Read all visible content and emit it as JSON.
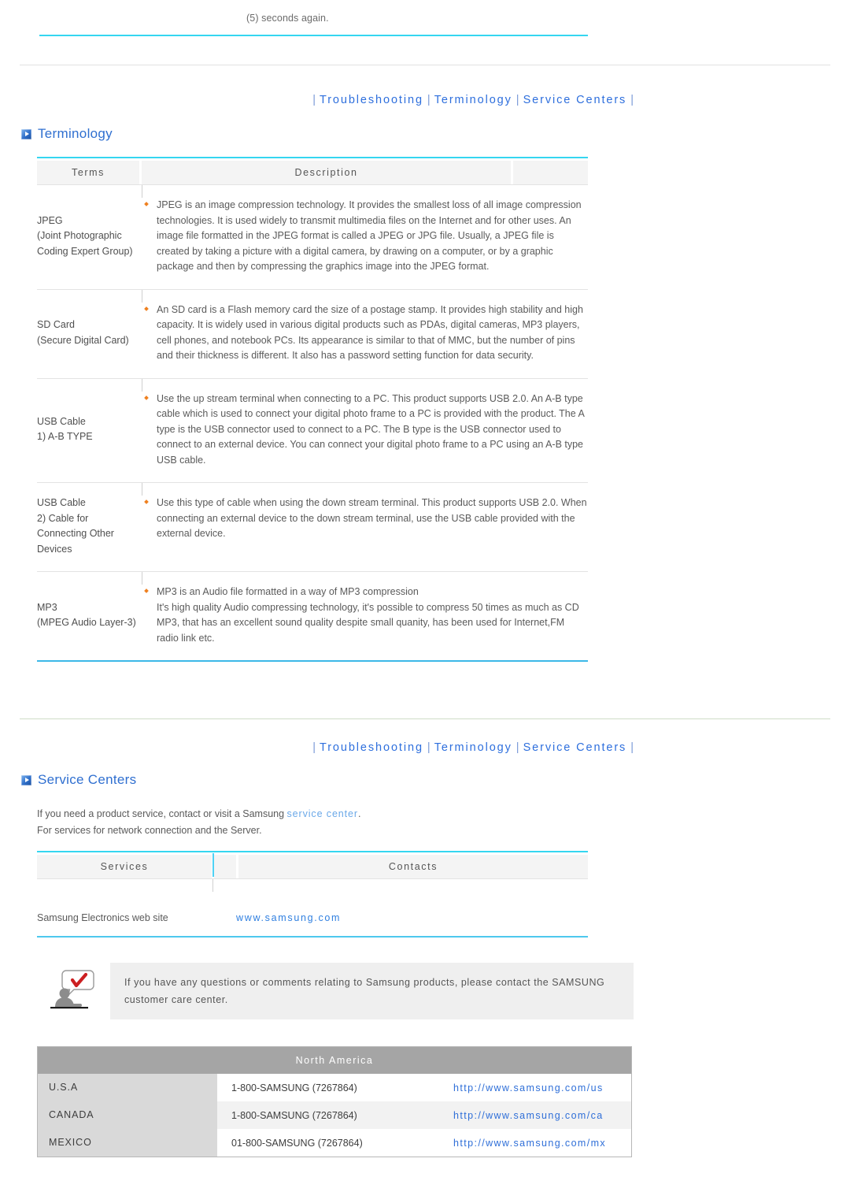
{
  "top_fragment": "(5) seconds again.",
  "nav": {
    "separator": "|",
    "items": [
      {
        "label": "Troubleshooting"
      },
      {
        "label": "Terminology"
      },
      {
        "label": "Service Centers"
      }
    ]
  },
  "colors": {
    "cyan_rule": "#35d6f0",
    "nav_link": "#2e6fdd",
    "heading": "#2f6fd0",
    "bullet": "#ef8020",
    "link": "#2f7fe0",
    "soft_link": "#6aa8e8",
    "na_header_bg": "#a5a5a5",
    "na_col1_bg": "#d9d9d9",
    "notice_bg": "#efefef"
  },
  "terminology": {
    "heading": "Terminology",
    "columns": {
      "terms": "Terms",
      "description": "Description",
      "blank": ""
    },
    "rows": [
      {
        "term_lines": [
          "JPEG",
          "(Joint Photographic",
          "Coding Expert Group)"
        ],
        "description": [
          "JPEG is an image compression technology. It provides the smallest loss of all image compression technologies. It is used widely to transmit multimedia files on the Internet and for other uses. An image file formatted in the JPEG format is called a JPEG or JPG file. Usually, a JPEG file is created by taking a picture with a digital camera, by drawing on a computer, or by a graphic package and then by compressing the graphics image into the JPEG format."
        ]
      },
      {
        "term_lines": [
          "SD Card",
          "(Secure Digital Card)"
        ],
        "description": [
          "An SD card is a Flash memory card the size of a postage stamp. It provides high stability and high capacity. It is widely used in various digital products such as PDAs, digital cameras, MP3 players, cell phones, and notebook PCs. Its appearance is similar to that of MMC, but the number of pins and their thickness is different. It also has a password setting function for data security."
        ]
      },
      {
        "term_lines": [
          "USB Cable",
          "1) A-B TYPE"
        ],
        "description": [
          "Use the up stream terminal when connecting to a PC. This product supports USB 2.0. An A-B type cable which is used to connect your digital photo frame to a PC is provided with the product. The A type is the USB connector used to connect to a PC. The B type is the USB connector used to connect to an external device. You can connect your digital photo frame to a PC using an A-B type USB cable."
        ]
      },
      {
        "term_lines": [
          "USB Cable",
          "2) Cable for",
          "Connecting Other",
          "Devices"
        ],
        "description": [
          "Use this type of cable when using the down stream terminal. This product supports USB 2.0. When connecting an external device to the down stream terminal, use the USB cable provided with the external device."
        ]
      },
      {
        "term_lines": [
          "MP3",
          "(MPEG Audio Layer-3)"
        ],
        "description": [
          "MP3 is an Audio file formatted in a way of MP3 compression",
          "It's high quality Audio compressing technology, it's possible to compress 50 times as much as CD",
          "MP3, that has an excellent sound quality despite small quanity, has been used for Internet,FM radio link etc."
        ]
      }
    ]
  },
  "service_centers": {
    "heading": "Service Centers",
    "intro_before": "If you need a product service, contact or visit a Samsung ",
    "intro_link": "service center",
    "intro_after": ".",
    "intro_line2": "For services for network connection and the Server.",
    "columns": {
      "services": "Services",
      "contacts": "Contacts"
    },
    "rows": [
      {
        "service": "Samsung Electronics web site",
        "contact": "www.samsung.com"
      }
    ],
    "notice": {
      "icon": "person-speech-check-icon",
      "text": "If you have any questions or comments relating to Samsung products, please contact the SAMSUNG customer care center."
    },
    "region_table": {
      "title": "North America",
      "rows": [
        {
          "country": "U.S.A",
          "phone": "1-800-SAMSUNG (7267864)",
          "url": "http://www.samsung.com/us"
        },
        {
          "country": "CANADA",
          "phone": "1-800-SAMSUNG (7267864)",
          "url": "http://www.samsung.com/ca"
        },
        {
          "country": "MEXICO",
          "phone": "01-800-SAMSUNG (7267864)",
          "url": "http://www.samsung.com/mx"
        }
      ]
    }
  }
}
